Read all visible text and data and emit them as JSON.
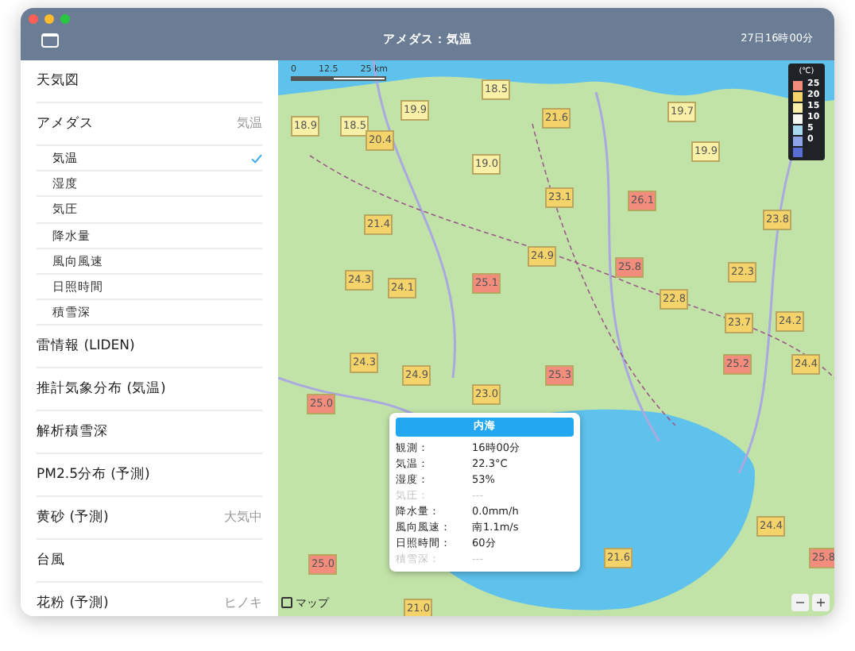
{
  "window": {
    "title": "アメダス：気温",
    "time": "27日16時00分"
  },
  "sidebar": {
    "items": [
      {
        "label": "天気図"
      },
      {
        "label": "アメダス",
        "value": "気温",
        "children": [
          {
            "label": "気温",
            "selected": true
          },
          {
            "label": "湿度",
            "selected": false
          },
          {
            "label": "気圧",
            "selected": false
          },
          {
            "label": "降水量",
            "selected": false
          },
          {
            "label": "風向風速",
            "selected": false
          },
          {
            "label": "日照時間",
            "selected": false
          },
          {
            "label": "積雪深",
            "selected": false
          }
        ]
      },
      {
        "label": "雷情報 (LIDEN)"
      },
      {
        "label": "推計気象分布 (気温)"
      },
      {
        "label": "解析積雪深"
      },
      {
        "label": "PM2.5分布 (予測)"
      },
      {
        "label": "黄砂 (予測)",
        "value": "大気中"
      },
      {
        "label": "台風"
      },
      {
        "label": "花粉 (予測)",
        "value": "ヒノキ"
      }
    ]
  },
  "map": {
    "scale": [
      "0",
      "12.5",
      "25 km"
    ],
    "legend": {
      "unit": "(℃)",
      "items": [
        {
          "label": "25",
          "color": "#f28c7c"
        },
        {
          "label": "20",
          "color": "#f5d36b"
        },
        {
          "label": "15",
          "color": "#f8f0a6"
        },
        {
          "label": "10",
          "color": "#f7f7f2"
        },
        {
          "label": "5",
          "color": "#a9d8f0"
        },
        {
          "label": "0",
          "color": "#8ea3e8"
        },
        {
          "color": "#5a6fd6"
        }
      ]
    },
    "markers": [
      {
        "value": "18.5",
        "color": "#f8f0a6"
      },
      {
        "value": "18.9",
        "color": "#f8f0a6"
      },
      {
        "value": "18.5",
        "color": "#f8f0a6"
      },
      {
        "value": "19.9",
        "color": "#f8f0a6"
      },
      {
        "value": "20.4",
        "color": "#f5d36b"
      },
      {
        "value": "21.6",
        "color": "#f5d36b"
      },
      {
        "value": "19.7",
        "color": "#f8f0a6"
      },
      {
        "value": "19.9",
        "color": "#f8f0a6"
      },
      {
        "value": "19.0",
        "color": "#f8f0a6"
      },
      {
        "value": "23.1",
        "color": "#f5d36b"
      },
      {
        "value": "26.1",
        "color": "#f28c7c"
      },
      {
        "value": "21.4",
        "color": "#f5d36b"
      },
      {
        "value": "23.8",
        "color": "#f5d36b"
      },
      {
        "value": "24.9",
        "color": "#f5d36b"
      },
      {
        "value": "25.8",
        "color": "#f28c7c"
      },
      {
        "value": "24.3",
        "color": "#f5d36b"
      },
      {
        "value": "24.1",
        "color": "#f5d36b"
      },
      {
        "value": "25.1",
        "color": "#f28c7c"
      },
      {
        "value": "22.8",
        "color": "#f5d36b"
      },
      {
        "value": "22.3",
        "color": "#f5d36b"
      },
      {
        "value": "24.2",
        "color": "#f5d36b"
      },
      {
        "value": "23.7",
        "color": "#f5d36b"
      },
      {
        "value": "24.3",
        "color": "#f5d36b"
      },
      {
        "value": "24.9",
        "color": "#f5d36b"
      },
      {
        "value": "25.0",
        "color": "#f28c7c"
      },
      {
        "value": "23.0",
        "color": "#f5d36b"
      },
      {
        "value": "25.2",
        "color": "#f28c7c"
      },
      {
        "value": "24.4",
        "color": "#f5d36b"
      },
      {
        "value": "25.3",
        "color": "#f28c7c"
      },
      {
        "value": "25.0",
        "color": "#f28c7c"
      },
      {
        "value": "21.0",
        "color": "#f5d36b"
      },
      {
        "value": "21.6",
        "color": "#f5d36b"
      },
      {
        "value": "24.4",
        "color": "#f5d36b"
      },
      {
        "value": "25.8",
        "color": "#f28c7c"
      }
    ],
    "popup": {
      "title": "内海",
      "rows": [
        {
          "label": "観測：",
          "value": "16時00分",
          "disabled": false
        },
        {
          "label": "気温：",
          "value": "22.3°C",
          "disabled": false
        },
        {
          "label": "湿度：",
          "value": "53%",
          "disabled": false
        },
        {
          "label": "気圧：",
          "value": "---",
          "disabled": true
        },
        {
          "label": "降水量：",
          "value": "0.0mm/h",
          "disabled": false
        },
        {
          "label": "風向風速：",
          "value": "南1.1m/s",
          "disabled": false
        },
        {
          "label": "日照時間：",
          "value": "60分",
          "disabled": false
        },
        {
          "label": "積雪深：",
          "value": "---",
          "disabled": true
        }
      ]
    },
    "map_mode": "マップ",
    "zoom": [
      "−",
      "+"
    ]
  }
}
